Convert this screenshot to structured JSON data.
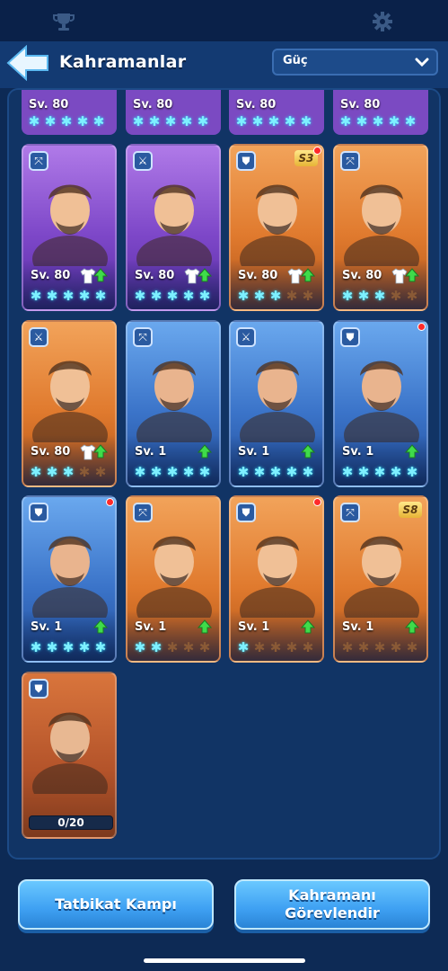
{
  "header": {
    "title": "Kahramanlar",
    "sort": {
      "selected": "Güç"
    }
  },
  "partial_row": [
    {
      "level": "Sv. 80",
      "stars_on": 5
    },
    {
      "level": "Sv. 80",
      "stars_on": 5
    },
    {
      "level": "Sv. 80",
      "stars_on": 5
    },
    {
      "level": "Sv. 80",
      "stars_on": 5
    }
  ],
  "heroes": [
    {
      "level": "Sv. 80",
      "color": "purple",
      "class_icon": "crossbow-icon",
      "stars_on": 5,
      "has_shirt": true,
      "red_dot": false,
      "badge": ""
    },
    {
      "level": "Sv. 80",
      "color": "purple",
      "class_icon": "sword-icon",
      "stars_on": 5,
      "has_shirt": true,
      "red_dot": false,
      "badge": ""
    },
    {
      "level": "Sv. 80",
      "color": "orange",
      "class_icon": "shield-icon",
      "stars_on": 3,
      "has_shirt": true,
      "red_dot": true,
      "badge": "S3"
    },
    {
      "level": "Sv. 80",
      "color": "orange",
      "class_icon": "crossbow-icon",
      "stars_on": 3,
      "has_shirt": true,
      "red_dot": false,
      "badge": ""
    },
    {
      "level": "Sv. 80",
      "color": "orange",
      "class_icon": "sword-icon",
      "stars_on": 3,
      "has_shirt": true,
      "red_dot": false,
      "badge": ""
    },
    {
      "level": "Sv. 1",
      "color": "blue",
      "class_icon": "crossbow-icon",
      "stars_on": 5,
      "has_shirt": false,
      "red_dot": false,
      "badge": ""
    },
    {
      "level": "Sv. 1",
      "color": "blue",
      "class_icon": "sword-icon",
      "stars_on": 5,
      "has_shirt": false,
      "red_dot": false,
      "badge": ""
    },
    {
      "level": "Sv. 1",
      "color": "blue",
      "class_icon": "shield-icon",
      "stars_on": 5,
      "has_shirt": false,
      "red_dot": true,
      "badge": ""
    },
    {
      "level": "Sv. 1",
      "color": "blue",
      "class_icon": "shield-icon",
      "stars_on": 5,
      "has_shirt": false,
      "red_dot": true,
      "badge": ""
    },
    {
      "level": "Sv. 1",
      "color": "orange",
      "class_icon": "crossbow-icon",
      "stars_on": 2,
      "has_shirt": false,
      "red_dot": false,
      "badge": ""
    },
    {
      "level": "Sv. 1",
      "color": "orange",
      "class_icon": "shield-icon",
      "stars_on": 1,
      "has_shirt": false,
      "red_dot": true,
      "badge": ""
    },
    {
      "level": "Sv. 1",
      "color": "orange",
      "class_icon": "crossbow-icon",
      "stars_on": 0,
      "has_shirt": false,
      "red_dot": false,
      "badge": "S8"
    }
  ],
  "locked_hero": {
    "class_icon": "shield-icon",
    "progress_text": "0/20",
    "progress_fraction": 0
  },
  "footer": {
    "left_button": "Tatbikat Kampı",
    "right_button_line1": "Kahramanı",
    "right_button_line2": "Görevlendir"
  },
  "colors": {
    "purple": "#7d47c8",
    "orange": "#e07a2e",
    "blue": "#3b74c9",
    "star_on": "#7ef0ff",
    "star_off": "#8a5a36",
    "button": "#3ea0f2"
  }
}
